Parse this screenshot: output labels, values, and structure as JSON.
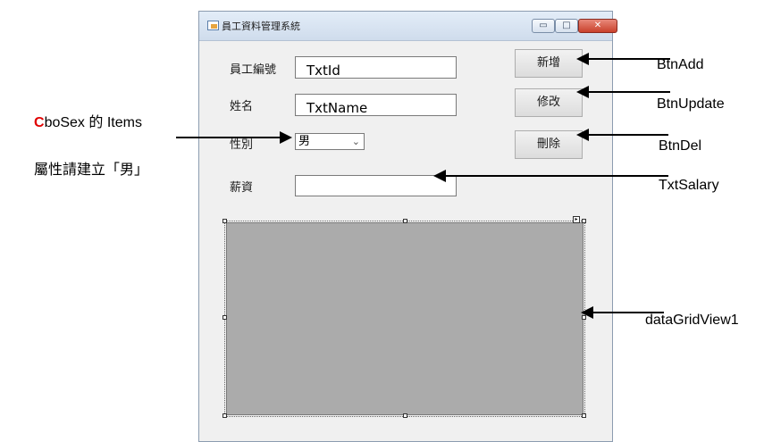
{
  "window": {
    "title": "員工資料管理系統",
    "minimize_glyph": "▭",
    "maximize_glyph": "□",
    "close_glyph": "✕"
  },
  "form": {
    "label_id": "員工編號",
    "label_name": "姓名",
    "label_sex": "性別",
    "label_salary": "薪資",
    "txt_id_value": "TxtId",
    "txt_name_value": "TxtName",
    "txt_salary_value": "",
    "sex_selected": "男",
    "combo_arrow_glyph": "⌄",
    "btn_add": "新增",
    "btn_update": "修改",
    "btn_del": "刪除"
  },
  "annotations": {
    "btn_add": "BtnAdd",
    "btn_update": "BtnUpdate",
    "btn_del": "BtnDel",
    "txt_salary": "TxtSalary",
    "grid": "dataGridView1",
    "combo_line1_c": "C",
    "combo_line1_rest": "boSex 的 Items",
    "combo_line2": "屬性請建立「男」"
  },
  "colors": {
    "grid_fill": "#ababab",
    "close_button": "#c9412c",
    "annotation_accent": "#e00000"
  }
}
